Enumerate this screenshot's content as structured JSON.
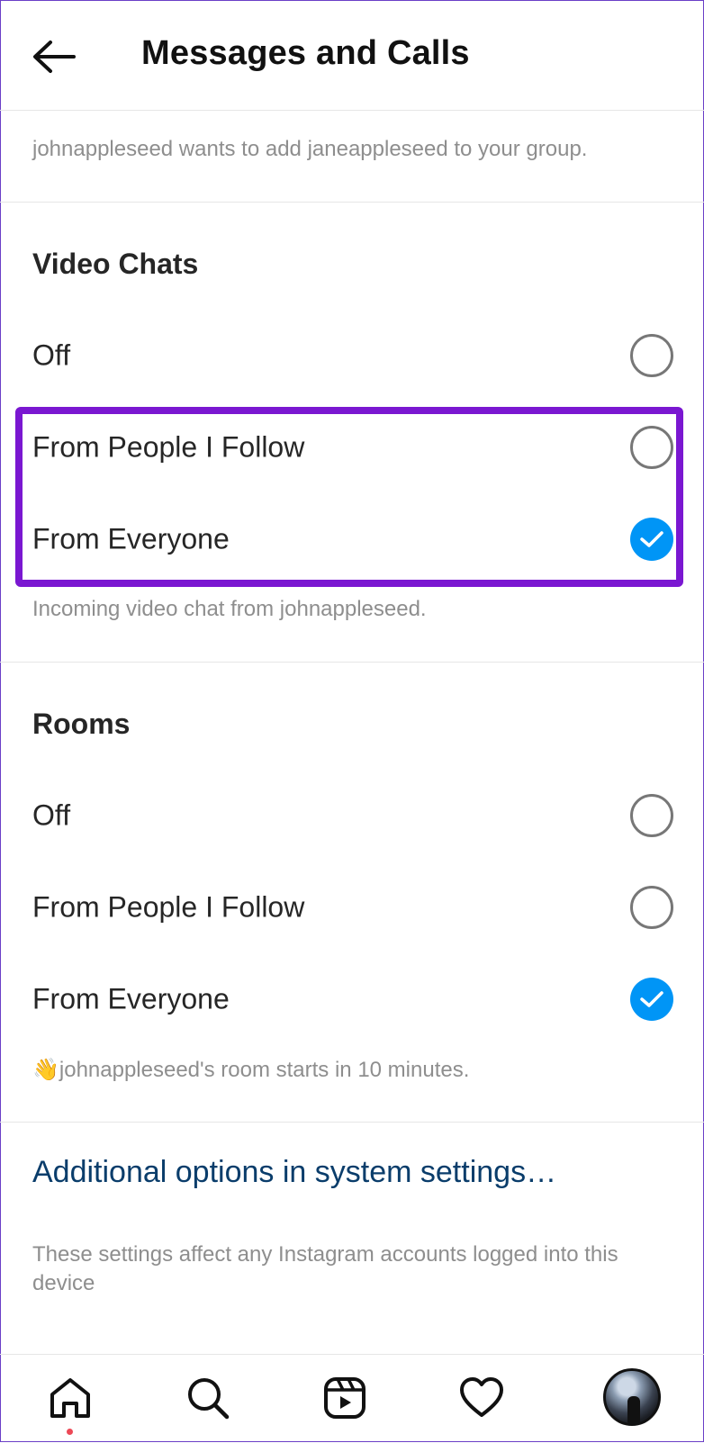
{
  "header": {
    "title": "Messages and Calls"
  },
  "group_preview": "johnappleseed wants to add janeappleseed to your group.",
  "video_chats": {
    "title": "Video Chats",
    "options": [
      {
        "label": "Off",
        "selected": false
      },
      {
        "label": "From People I Follow",
        "selected": false
      },
      {
        "label": "From Everyone",
        "selected": true
      }
    ],
    "preview": "Incoming video chat from johnappleseed."
  },
  "rooms": {
    "title": "Rooms",
    "options": [
      {
        "label": "Off",
        "selected": false
      },
      {
        "label": "From People I Follow",
        "selected": false
      },
      {
        "label": "From Everyone",
        "selected": true
      }
    ],
    "preview_emoji": "👋",
    "preview": "johnappleseed's room starts in 10 minutes."
  },
  "additional_link": "Additional options in system settings…",
  "footnote": "These settings affect any Instagram accounts logged into this device",
  "colors": {
    "accent": "#0095f6",
    "highlight": "#7a17d1",
    "link": "#0a3d6b"
  },
  "tabbar": {
    "icons": [
      "home-icon",
      "search-icon",
      "reels-icon",
      "heart-icon",
      "profile-avatar"
    ]
  }
}
